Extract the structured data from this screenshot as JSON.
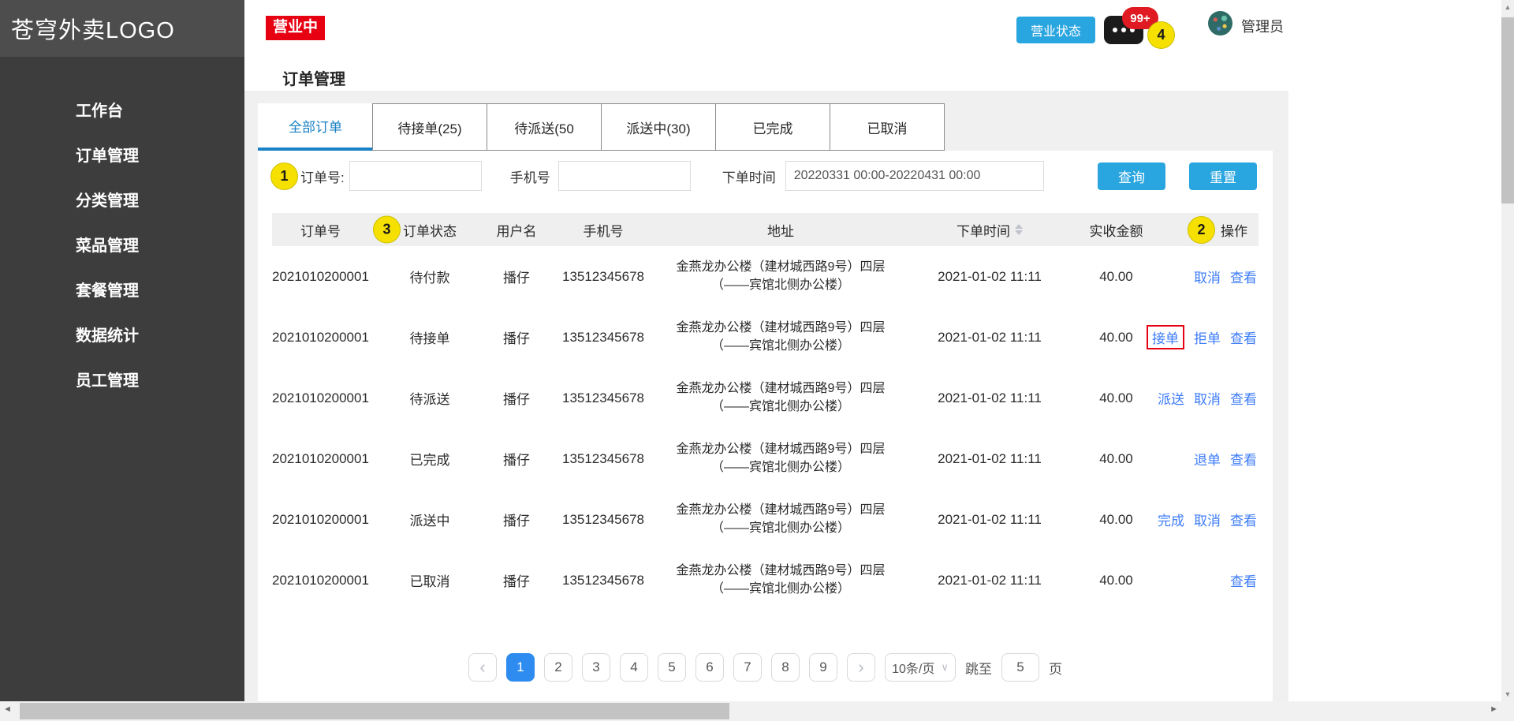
{
  "colors": {
    "sidebar_dark": "#3d3d3d",
    "accent_blue": "#29a5df",
    "tab_blue": "#1981c5",
    "link_blue": "#3e7cf8",
    "active_page_blue": "#2e8cf0",
    "status_red": "#e60012",
    "annotation_yellow": "#f6e000"
  },
  "icons": {
    "prev": "‹",
    "next": "›",
    "caret": "∨",
    "scroll_up": "▲",
    "scroll_down": "▼",
    "scroll_left": "◄",
    "scroll_right": "►"
  },
  "sidebar": {
    "logo": "苍穹外卖LOGO",
    "items": [
      {
        "label": "工作台"
      },
      {
        "label": "订单管理"
      },
      {
        "label": "分类管理"
      },
      {
        "label": "菜品管理"
      },
      {
        "label": "套餐管理"
      },
      {
        "label": "数据统计"
      },
      {
        "label": "员工管理"
      }
    ]
  },
  "header": {
    "status_badge": "营业中",
    "page_title": "订单管理",
    "business_status_button": "营业状态",
    "notification_count": "99+",
    "annotation_4": "4",
    "user_name": "管理员"
  },
  "tabs": [
    {
      "label": "全部订单"
    },
    {
      "label": "待接单(25)"
    },
    {
      "label": "待派送(50"
    },
    {
      "label": "派送中(30)"
    },
    {
      "label": "已完成"
    },
    {
      "label": "已取消"
    }
  ],
  "search": {
    "annotation_1": "1",
    "order_no_label": "订单号:",
    "order_no_value": "",
    "phone_label": "手机号",
    "phone_value": "",
    "time_label": "下单时间",
    "time_value": "20220331 00:00-20220431 00:00",
    "query_button": "查询",
    "reset_button": "重置"
  },
  "table": {
    "annotation_2": "2",
    "annotation_3": "3",
    "headers": [
      "订单号",
      "订单状态",
      "用户名",
      "手机号",
      "地址",
      "下单时间",
      "实收金额",
      "操作"
    ],
    "rows": [
      {
        "order_no": "2021010200001",
        "status": "待付款",
        "user": "播仔",
        "phone": "13512345678",
        "address_line1": "金燕龙办公楼（建材城西路9号）四层",
        "address_line2": "（——宾馆北侧办公楼）",
        "time": "2021-01-02 11:11",
        "amount": "40.00",
        "actions": [
          {
            "label": "取消"
          },
          {
            "label": "查看"
          }
        ]
      },
      {
        "order_no": "2021010200001",
        "status": "待接单",
        "user": "播仔",
        "phone": "13512345678",
        "address_line1": "金燕龙办公楼（建材城西路9号）四层",
        "address_line2": "（——宾馆北侧办公楼）",
        "time": "2021-01-02 11:11",
        "amount": "40.00",
        "actions": [
          {
            "label": "接单",
            "highlighted": true
          },
          {
            "label": "拒单"
          },
          {
            "label": "查看"
          }
        ]
      },
      {
        "order_no": "2021010200001",
        "status": "待派送",
        "user": "播仔",
        "phone": "13512345678",
        "address_line1": "金燕龙办公楼（建材城西路9号）四层",
        "address_line2": "（——宾馆北侧办公楼）",
        "time": "2021-01-02 11:11",
        "amount": "40.00",
        "actions": [
          {
            "label": "派送"
          },
          {
            "label": "取消"
          },
          {
            "label": "查看"
          }
        ]
      },
      {
        "order_no": "2021010200001",
        "status": "已完成",
        "user": "播仔",
        "phone": "13512345678",
        "address_line1": "金燕龙办公楼（建材城西路9号）四层",
        "address_line2": "（——宾馆北侧办公楼）",
        "time": "2021-01-02 11:11",
        "amount": "40.00",
        "actions": [
          {
            "label": "退单"
          },
          {
            "label": "查看"
          }
        ]
      },
      {
        "order_no": "2021010200001",
        "status": "派送中",
        "user": "播仔",
        "phone": "13512345678",
        "address_line1": "金燕龙办公楼（建材城西路9号）四层",
        "address_line2": "（——宾馆北侧办公楼）",
        "time": "2021-01-02 11:11",
        "amount": "40.00",
        "actions": [
          {
            "label": "完成"
          },
          {
            "label": "取消"
          },
          {
            "label": "查看"
          }
        ]
      },
      {
        "order_no": "2021010200001",
        "status": "已取消",
        "user": "播仔",
        "phone": "13512345678",
        "address_line1": "金燕龙办公楼（建材城西路9号）四层",
        "address_line2": "（——宾馆北侧办公楼）",
        "time": "2021-01-02 11:11",
        "amount": "40.00",
        "actions": [
          {
            "label": "查看"
          }
        ]
      }
    ]
  },
  "pagination": {
    "pages": [
      "1",
      "2",
      "3",
      "4",
      "5",
      "6",
      "7",
      "8",
      "9"
    ],
    "active_page": "1",
    "page_size": "10条/页",
    "jump_label": "跳至",
    "jump_value": "5",
    "page_unit": "页"
  }
}
